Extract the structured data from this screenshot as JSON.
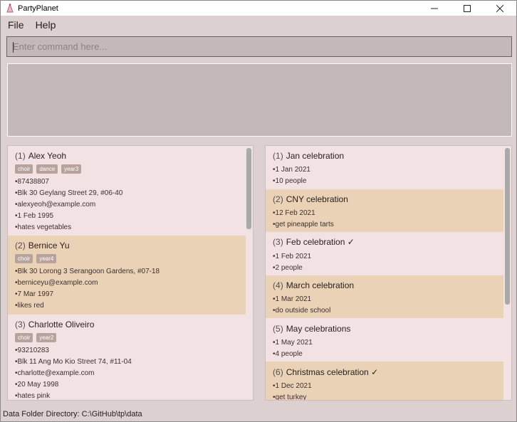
{
  "window": {
    "title": "PartyPlanet",
    "minimize": "—",
    "maximize": "☐",
    "close": "✕"
  },
  "menu": {
    "file": "File",
    "help": "Help"
  },
  "command": {
    "placeholder": "Enter command here..."
  },
  "persons": [
    {
      "index": "1",
      "name": "Alex Yeoh",
      "tags": [
        "choir",
        "dance",
        "year3"
      ],
      "details": [
        "•87438807",
        "•Blk 30 Geylang Street 29, #06-40",
        "•alexyeoh@example.com",
        "•1 Feb 1995",
        "•hates vegetables"
      ]
    },
    {
      "index": "2",
      "name": "Bernice Yu",
      "tags": [
        "choir",
        "year4"
      ],
      "details": [
        "•Blk 30 Lorong 3 Serangoon Gardens, #07-18",
        "•berniceyu@example.com",
        "•7 Mar 1997",
        "•likes red"
      ]
    },
    {
      "index": "3",
      "name": "Charlotte Oliveiro",
      "tags": [
        "choir",
        "year2"
      ],
      "details": [
        "•93210283",
        "•Blk 11 Ang Mo Kio Street 74, #11-04",
        "•charlotte@example.com",
        "•20 May 1998",
        "•hates pink"
      ]
    }
  ],
  "events": [
    {
      "index": "1",
      "name": "Jan celebration",
      "done": "",
      "details": [
        "•1 Jan 2021",
        "•10 people"
      ]
    },
    {
      "index": "2",
      "name": "CNY celebration",
      "done": "",
      "details": [
        "•12 Feb 2021",
        "•get pineapple tarts"
      ]
    },
    {
      "index": "3",
      "name": "Feb celebration",
      "done": "✓",
      "details": [
        "•1 Feb 2021",
        "•2 people"
      ]
    },
    {
      "index": "4",
      "name": "March celebration",
      "done": "",
      "details": [
        "•1 Mar 2021",
        "•do outside school"
      ]
    },
    {
      "index": "5",
      "name": "May celebrations",
      "done": "",
      "details": [
        "•1 May 2021",
        "•4 people"
      ]
    },
    {
      "index": "6",
      "name": "Christmas celebration",
      "done": "✓",
      "details": [
        "•1 Dec 2021",
        "•get turkey"
      ]
    }
  ],
  "status": {
    "text": "Data Folder Directory: C:\\GitHub\\tp\\data"
  },
  "colors": {
    "accent_card": "#e9d2b6",
    "panel_bg": "#f3e2e4",
    "window_bg": "#dcd0d0",
    "tag_bg": "#b8a39c"
  },
  "icons": {
    "app": "party-hat-icon",
    "minimize": "minimize-icon",
    "maximize": "maximize-icon",
    "close": "close-icon"
  }
}
